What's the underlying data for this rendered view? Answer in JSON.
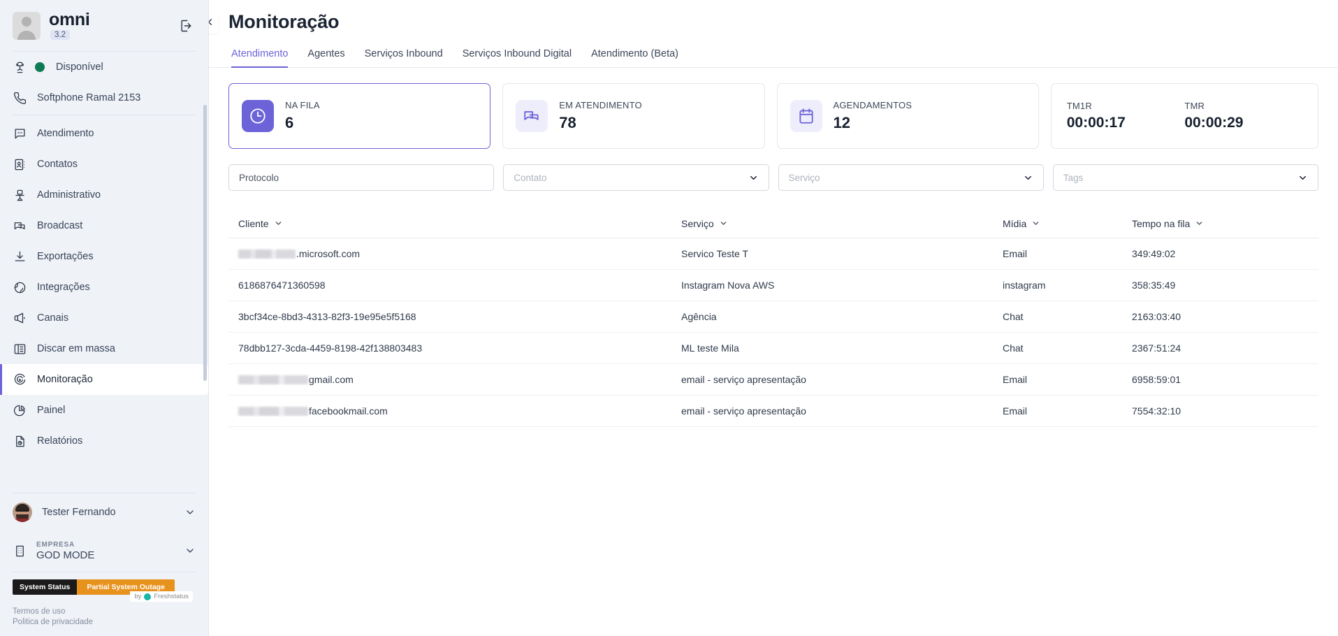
{
  "sidebar": {
    "brand": {
      "name": "omni",
      "version": "3.2",
      "avatar_icon": "user-avatar-icon",
      "logout_icon": "logout-icon"
    },
    "status": {
      "label": "Disponível",
      "icon": "agent-headset-icon",
      "dot_color": "#0f7b55"
    },
    "softphone": {
      "label": "Softphone Ramal 2153",
      "icon": "phone-icon"
    },
    "nav": [
      {
        "label": "Atendimento",
        "icon": "chat-bubble-icon",
        "active": false
      },
      {
        "label": "Contatos",
        "icon": "contacts-book-icon",
        "active": false
      },
      {
        "label": "Administrativo",
        "icon": "office-chair-icon",
        "active": false
      },
      {
        "label": "Broadcast",
        "icon": "broadcast-bubbles-icon",
        "active": false
      },
      {
        "label": "Exportações",
        "icon": "download-icon",
        "active": false
      },
      {
        "label": "Integrações",
        "icon": "globe-icon",
        "active": false
      },
      {
        "label": "Canais",
        "icon": "megaphone-icon",
        "active": false
      },
      {
        "label": "Discar em massa",
        "icon": "desk-phone-icon",
        "active": false
      },
      {
        "label": "Monitoração",
        "icon": "target-icon",
        "active": true
      },
      {
        "label": "Painel",
        "icon": "pie-chart-icon",
        "active": false
      },
      {
        "label": "Relatórios",
        "icon": "report-document-icon",
        "active": false
      }
    ],
    "user": {
      "name": "Tester Fernando",
      "chevron_icon": "chevron-down-icon",
      "avatar_icon": "user-photo-avatar"
    },
    "company": {
      "label": "EMPRESA",
      "name": "GOD MODE",
      "icon": "building-icon",
      "chevron_icon": "chevron-down-icon"
    },
    "system_status": {
      "left_label": "System Status",
      "right_label": "Partial System Outage",
      "by_label": "by",
      "provider": "Freshstatus",
      "left_color": "#1b1b1b",
      "right_color": "#e8921e"
    },
    "legal": [
      "Termos de uso",
      "Politica de privacidade"
    ]
  },
  "header": {
    "title": "Monitoração",
    "collapse_icon": "chevron-left-icon",
    "tabs": [
      {
        "label": "Atendimento",
        "active": true
      },
      {
        "label": "Agentes",
        "active": false
      },
      {
        "label": "Serviços Inbound",
        "active": false
      },
      {
        "label": "Serviços Inbound Digital",
        "active": false
      },
      {
        "label": "Atendimento (Beta)",
        "active": false
      }
    ],
    "accent_color": "#6c63d9"
  },
  "cards": [
    {
      "label": "NA FILA",
      "value": "6",
      "icon": "clock-icon",
      "selected": true
    },
    {
      "label": "EM ATENDIMENTO",
      "value": "78",
      "icon": "chat-bubbles-icon",
      "selected": false
    },
    {
      "label": "AGENDAMENTOS",
      "value": "12",
      "icon": "calendar-icon",
      "selected": false
    }
  ],
  "metrics": {
    "tm1r": {
      "label": "TM1R",
      "value": "00:00:17"
    },
    "tmr": {
      "label": "TMR",
      "value": "00:00:29"
    }
  },
  "filters": {
    "protocolo": {
      "placeholder": "Protocolo",
      "value": ""
    },
    "contato": {
      "placeholder": "Contato",
      "value": "",
      "chevron_icon": "chevron-down-icon"
    },
    "servico": {
      "placeholder": "Serviço",
      "value": "",
      "chevron_icon": "chevron-down-icon"
    },
    "tags": {
      "placeholder": "Tags",
      "value": "",
      "chevron_icon": "chevron-down-icon"
    }
  },
  "table": {
    "columns": [
      {
        "label": "Cliente",
        "sort_icon": "chevron-down-icon"
      },
      {
        "label": "Serviço",
        "sort_icon": "chevron-down-icon"
      },
      {
        "label": "Mídia",
        "sort_icon": "chevron-down-icon"
      },
      {
        "label": "Tempo na fila",
        "sort_icon": "chevron-down-icon"
      }
    ],
    "rows": [
      {
        "cliente_redacted_width": 82,
        "cliente": ".microsoft.com",
        "servico": "Servico Teste T",
        "midia": "Email",
        "tempo": "349:49:02"
      },
      {
        "cliente_redacted_width": 0,
        "cliente": "6186876471360598",
        "servico": "Instagram Nova AWS",
        "midia": "instagram",
        "tempo": "358:35:49"
      },
      {
        "cliente_redacted_width": 0,
        "cliente": "3bcf34ce-8bd3-4313-82f3-19e95e5f5168",
        "servico": "Agência",
        "midia": "Chat",
        "tempo": "2163:03:40"
      },
      {
        "cliente_redacted_width": 0,
        "cliente": "78dbb127-3cda-4459-8198-42f138803483",
        "servico": "ML teste Mila",
        "midia": "Chat",
        "tempo": "2367:51:24"
      },
      {
        "cliente_redacted_width": 100,
        "cliente": "gmail.com",
        "servico": "email - serviço apresentação",
        "midia": "Email",
        "tempo": "6958:59:01"
      },
      {
        "cliente_redacted_width": 100,
        "cliente": "facebookmail.com",
        "servico": "email - serviço apresentação",
        "midia": "Email",
        "tempo": "7554:32:10"
      }
    ]
  }
}
